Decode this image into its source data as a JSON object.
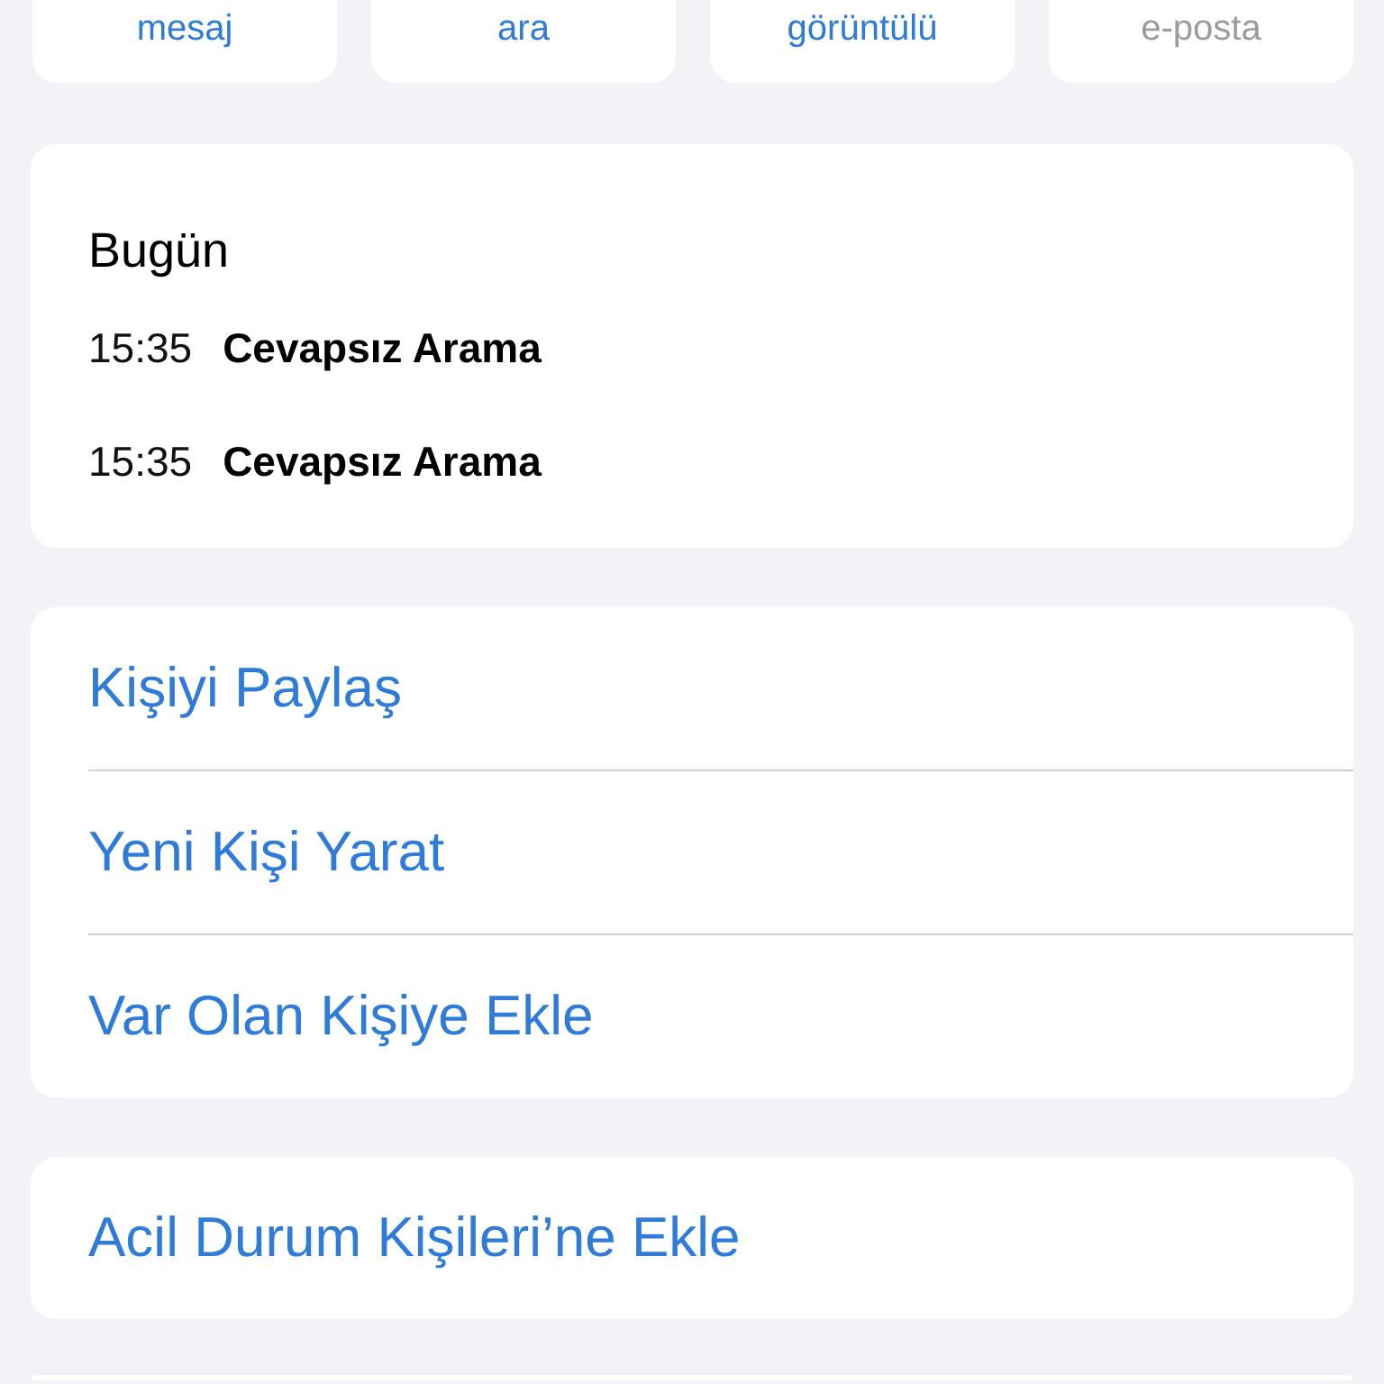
{
  "actions": [
    {
      "label": "mesaj",
      "disabled": false
    },
    {
      "label": "ara",
      "disabled": false
    },
    {
      "label": "görüntülü",
      "disabled": false
    },
    {
      "label": "e-posta",
      "disabled": true
    }
  ],
  "recents": {
    "heading": "Bugün",
    "calls": [
      {
        "time": "15:35",
        "label": "Cevapsız Arama"
      },
      {
        "time": "15:35",
        "label": "Cevapsız Arama"
      }
    ]
  },
  "contact_options": [
    "Kişiyi Paylaş",
    "Yeni Kişi Yarat",
    "Var Olan Kişiye Ekle"
  ],
  "emergency": {
    "label": "Acil Durum Kişileri’ne Ekle"
  }
}
